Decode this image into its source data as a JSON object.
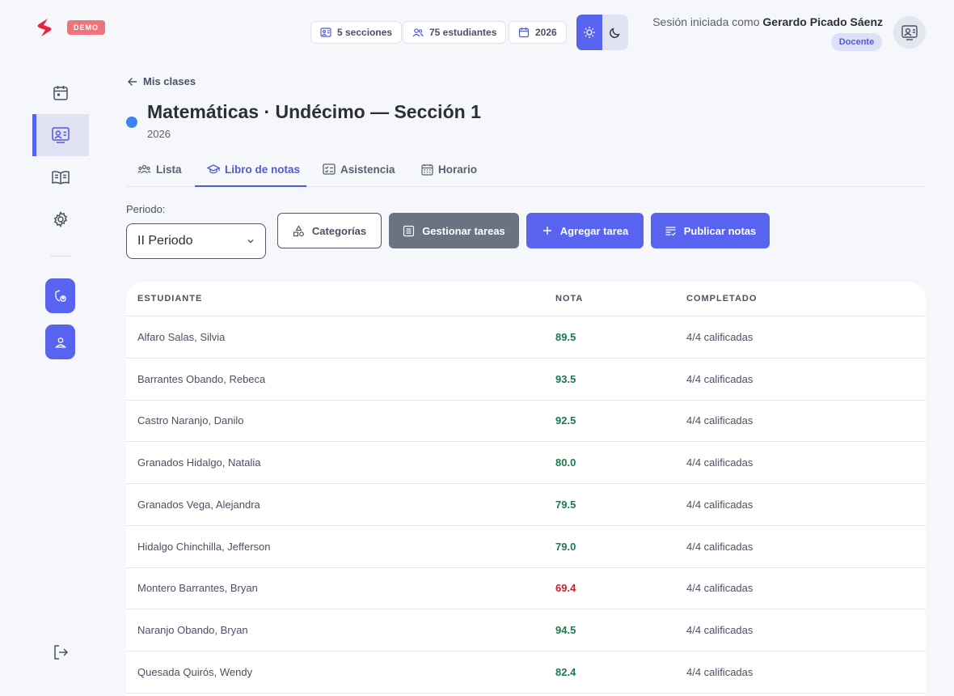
{
  "brand": {
    "badge": "DEMO",
    "logo_color": "#e8213a"
  },
  "stats": [
    {
      "icon": "sections-icon",
      "label": "5 secciones"
    },
    {
      "icon": "students-icon",
      "label": "75 estudiantes"
    },
    {
      "icon": "calendar-icon",
      "label": "2026"
    }
  ],
  "theme": {
    "active": "light"
  },
  "session": {
    "prefix": "Sesión iniciada como",
    "user": "Gerardo Picado Sáenz",
    "role": "Docente"
  },
  "sidebar": {
    "items": [
      {
        "icon": "calendar-icon",
        "active": false
      },
      {
        "icon": "classroom-icon",
        "active": true
      },
      {
        "icon": "book-icon",
        "active": false
      },
      {
        "icon": "gear-icon",
        "active": false
      }
    ],
    "squares": [
      {
        "icon": "shield-user-icon"
      },
      {
        "icon": "user-icon"
      }
    ],
    "logout_icon": "logout-icon"
  },
  "header": {
    "back_label": "Mis clases",
    "title": "Matemáticas · Undécimo — Sección 1",
    "year": "2026",
    "class_color": "#3d86f2"
  },
  "tabs": [
    {
      "label": "Lista",
      "icon": "group-icon",
      "active": false
    },
    {
      "label": "Libro de notas",
      "icon": "graduation-cap-icon",
      "active": true
    },
    {
      "label": "Asistencia",
      "icon": "checklist-icon",
      "active": false
    },
    {
      "label": "Horario",
      "icon": "calendar-grid-icon",
      "active": false
    }
  ],
  "toolbar": {
    "period_label": "Periodo:",
    "period_value": "II Periodo",
    "categories_label": "Categorías",
    "manage_label": "Gestionar tareas",
    "add_label": "Agregar tarea",
    "publish_label": "Publicar notas"
  },
  "table": {
    "headers": {
      "student": "ESTUDIANTE",
      "grade": "NOTA",
      "completed": "COMPLETADO"
    },
    "colors": {
      "pass": "#1b7a4b",
      "fail": "#cc1f2a"
    },
    "rows": [
      {
        "student": "Alfaro Salas, Silvia",
        "grade": "89.5",
        "status": "pass",
        "completed": "4/4 calificadas"
      },
      {
        "student": "Barrantes Obando, Rebeca",
        "grade": "93.5",
        "status": "pass",
        "completed": "4/4 calificadas"
      },
      {
        "student": "Castro Naranjo, Danilo",
        "grade": "92.5",
        "status": "pass",
        "completed": "4/4 calificadas"
      },
      {
        "student": "Granados Hidalgo, Natalia",
        "grade": "80.0",
        "status": "pass",
        "completed": "4/4 calificadas"
      },
      {
        "student": "Granados Vega, Alejandra",
        "grade": "79.5",
        "status": "pass",
        "completed": "4/4 calificadas"
      },
      {
        "student": "Hidalgo Chinchilla, Jefferson",
        "grade": "79.0",
        "status": "pass",
        "completed": "4/4 calificadas"
      },
      {
        "student": "Montero Barrantes, Bryan",
        "grade": "69.4",
        "status": "fail",
        "completed": "4/4 calificadas"
      },
      {
        "student": "Naranjo Obando, Bryan",
        "grade": "94.5",
        "status": "pass",
        "completed": "4/4 calificadas"
      },
      {
        "student": "Quesada Quirós, Wendy",
        "grade": "82.4",
        "status": "pass",
        "completed": "4/4 calificadas"
      }
    ]
  }
}
